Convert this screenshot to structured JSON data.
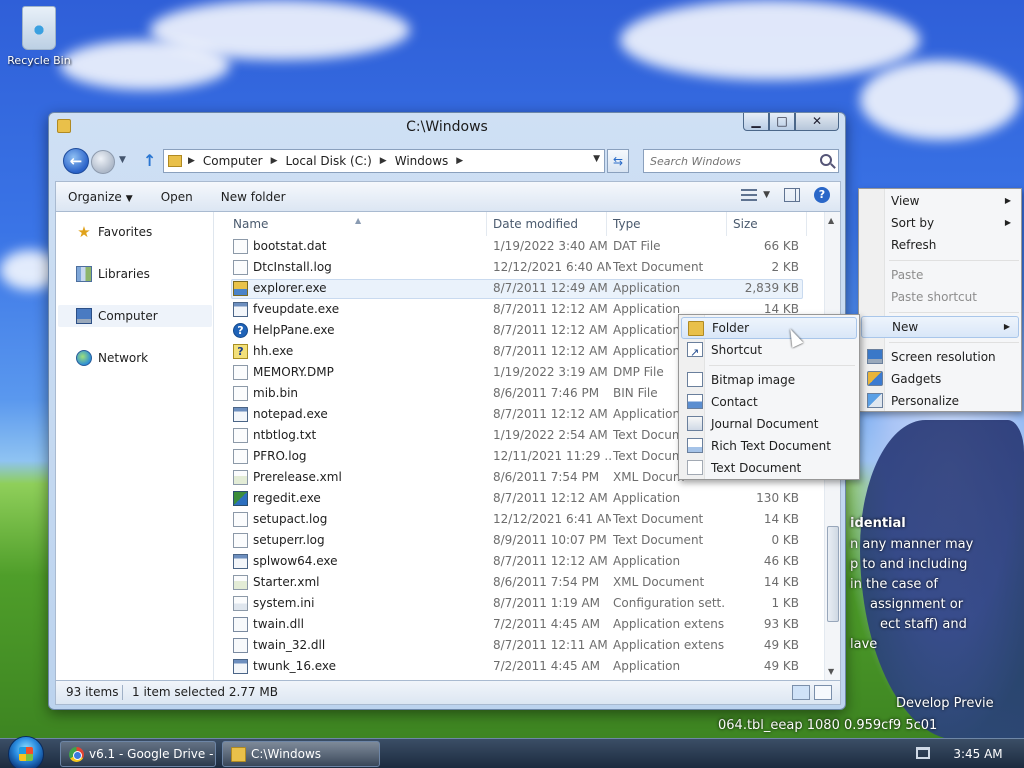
{
  "desktop": {
    "recycle_bin_label": "Recycle Bin",
    "wallpaper_text": {
      "line1": "idential",
      "line2": "n any manner may",
      "line3": "p to and including",
      "line4": "in the case of",
      "line5": "assignment or",
      "line6": "ect staff) and",
      "line7": "lave",
      "line8": "Develop  Previe",
      "line9": "064.tbl_eeap  1080  0.959cf9  5c01"
    }
  },
  "window": {
    "title": "C:\\Windows",
    "caption": {
      "minimize": "▁",
      "maximize": "□",
      "close": "✕"
    },
    "address": {
      "crumbs": [
        "Computer",
        "Local Disk (C:)",
        "Windows"
      ]
    },
    "search": {
      "placeholder": "Search Windows"
    },
    "commands": {
      "organize": "Organize",
      "open": "Open",
      "new_folder": "New folder"
    },
    "nav": {
      "favorites": "Favorites",
      "libraries": "Libraries",
      "computer": "Computer",
      "network": "Network"
    },
    "columns": {
      "name": "Name",
      "date": "Date modified",
      "type": "Type",
      "size": "Size"
    },
    "files": [
      {
        "name": "bootstat.dat",
        "date": "1/19/2022 3:40 AM",
        "type": "DAT File",
        "size": "66 KB",
        "icon": "doc-icon"
      },
      {
        "name": "DtcInstall.log",
        "date": "12/12/2021 6:40 AM",
        "type": "Text Document",
        "size": "2 KB",
        "icon": "text-doc-icon"
      },
      {
        "name": "explorer.exe",
        "date": "8/7/2011 12:49 AM",
        "type": "Application",
        "size": "2,839 KB",
        "icon": "explorer-icon",
        "selected": true
      },
      {
        "name": "fveupdate.exe",
        "date": "8/7/2011 12:12 AM",
        "type": "Application",
        "size": "14 KB",
        "icon": "app-icon"
      },
      {
        "name": "HelpPane.exe",
        "date": "8/7/2011 12:12 AM",
        "type": "Application",
        "size": "",
        "icon": "help-icon"
      },
      {
        "name": "hh.exe",
        "date": "8/7/2011 12:12 AM",
        "type": "Application",
        "size": "",
        "icon": "hh-icon"
      },
      {
        "name": "MEMORY.DMP",
        "date": "1/19/2022 3:19 AM",
        "type": "DMP File",
        "size": "",
        "icon": "doc-icon"
      },
      {
        "name": "mib.bin",
        "date": "8/6/2011 7:46 PM",
        "type": "BIN File",
        "size": "",
        "icon": "doc-icon"
      },
      {
        "name": "notepad.exe",
        "date": "8/7/2011 12:12 AM",
        "type": "Application",
        "size": "",
        "icon": "notepad-icon"
      },
      {
        "name": "ntbtlog.txt",
        "date": "1/19/2022 2:54 AM",
        "type": "Text Docum",
        "size": "",
        "icon": "text-doc-icon"
      },
      {
        "name": "PFRO.log",
        "date": "12/11/2021 11:29 ...",
        "type": "Text Docum",
        "size": "",
        "icon": "text-doc-icon"
      },
      {
        "name": "Prerelease.xml",
        "date": "8/6/2011 7:54 PM",
        "type": "XML Docum",
        "size": "",
        "icon": "xml-icon"
      },
      {
        "name": "regedit.exe",
        "date": "8/7/2011 12:12 AM",
        "type": "Application",
        "size": "130 KB",
        "icon": "regedit-icon"
      },
      {
        "name": "setupact.log",
        "date": "12/12/2021 6:41 AM",
        "type": "Text Document",
        "size": "14 KB",
        "icon": "text-doc-icon"
      },
      {
        "name": "setuperr.log",
        "date": "8/9/2011 10:07 PM",
        "type": "Text Document",
        "size": "0 KB",
        "icon": "text-doc-icon"
      },
      {
        "name": "splwow64.exe",
        "date": "8/7/2011 12:12 AM",
        "type": "Application",
        "size": "46 KB",
        "icon": "app-icon"
      },
      {
        "name": "Starter.xml",
        "date": "8/6/2011 7:54 PM",
        "type": "XML Document",
        "size": "14 KB",
        "icon": "xml-icon"
      },
      {
        "name": "system.ini",
        "date": "8/7/2011 1:19 AM",
        "type": "Configuration sett...",
        "size": "1 KB",
        "icon": "ini-icon"
      },
      {
        "name": "twain.dll",
        "date": "7/2/2011 4:45 AM",
        "type": "Application extens...",
        "size": "93 KB",
        "icon": "dll-icon"
      },
      {
        "name": "twain_32.dll",
        "date": "8/7/2011 12:11 AM",
        "type": "Application extens...",
        "size": "49 KB",
        "icon": "dll-icon"
      },
      {
        "name": "twunk_16.exe",
        "date": "7/2/2011 4:45 AM",
        "type": "Application",
        "size": "49 KB",
        "icon": "app-icon"
      }
    ],
    "status": {
      "count": "93 items",
      "selection": "1 item selected  2.77 MB"
    }
  },
  "context_menu": {
    "view": "View",
    "sort_by": "Sort by",
    "refresh": "Refresh",
    "paste": "Paste",
    "paste_shortcut": "Paste shortcut",
    "new": "New",
    "screen_resolution": "Screen resolution",
    "gadgets": "Gadgets",
    "personalize": "Personalize"
  },
  "new_submenu": {
    "folder": "Folder",
    "shortcut": "Shortcut",
    "bitmap": "Bitmap image",
    "contact": "Contact",
    "journal": "Journal Document",
    "rtf": "Rich Text Document",
    "text": "Text Document"
  },
  "taskbar": {
    "items": [
      {
        "label": "v6.1 - Google Drive - ...",
        "icon": "chrome-icon"
      },
      {
        "label": "C:\\Windows",
        "icon": "folder-icon"
      }
    ],
    "clock": "3:45 AM"
  }
}
